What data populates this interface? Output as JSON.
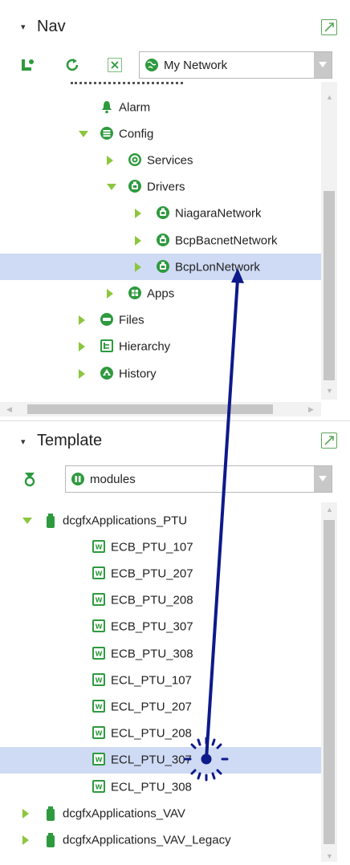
{
  "nav": {
    "title": "Nav",
    "network_select": "My Network",
    "tree": [
      {
        "label": "Alarm",
        "icon": "alarm-bell-icon",
        "toggle": "none",
        "level": 0
      },
      {
        "label": "Config",
        "icon": "config-database-icon",
        "toggle": "down",
        "level": 0
      },
      {
        "label": "Services",
        "icon": "services-gear-icon",
        "toggle": "right",
        "level": 1
      },
      {
        "label": "Drivers",
        "icon": "drivers-icon",
        "toggle": "down",
        "level": 1
      },
      {
        "label": "NiagaraNetwork",
        "icon": "network-icon",
        "toggle": "right",
        "level": 2
      },
      {
        "label": "BcpBacnetNetwork",
        "icon": "network-icon",
        "toggle": "right",
        "level": 2
      },
      {
        "label": "BcpLonNetwork",
        "icon": "network-icon",
        "toggle": "right",
        "level": 2,
        "selected": true
      },
      {
        "label": "Apps",
        "icon": "apps-icon",
        "toggle": "right",
        "level": 1
      },
      {
        "label": "Files",
        "icon": "files-drive-icon",
        "toggle": "right",
        "level": 0
      },
      {
        "label": "Hierarchy",
        "icon": "hierarchy-icon",
        "toggle": "right",
        "level": 0
      },
      {
        "label": "History",
        "icon": "history-icon",
        "toggle": "right",
        "level": 0
      }
    ]
  },
  "template": {
    "title": "Template",
    "module_select": "modules",
    "tree": [
      {
        "label": "dcgfxApplications_PTU",
        "icon": "module-jar-icon",
        "toggle": "down",
        "level": 0
      },
      {
        "label": "ECB_PTU_107",
        "icon": "app-template-icon",
        "toggle": "none",
        "level": 1
      },
      {
        "label": "ECB_PTU_207",
        "icon": "app-template-icon",
        "toggle": "none",
        "level": 1
      },
      {
        "label": "ECB_PTU_208",
        "icon": "app-template-icon",
        "toggle": "none",
        "level": 1
      },
      {
        "label": "ECB_PTU_307",
        "icon": "app-template-icon",
        "toggle": "none",
        "level": 1
      },
      {
        "label": "ECB_PTU_308",
        "icon": "app-template-icon",
        "toggle": "none",
        "level": 1
      },
      {
        "label": "ECL_PTU_107",
        "icon": "app-template-icon",
        "toggle": "none",
        "level": 1
      },
      {
        "label": "ECL_PTU_207",
        "icon": "app-template-icon",
        "toggle": "none",
        "level": 1
      },
      {
        "label": "ECL_PTU_208",
        "icon": "app-template-icon",
        "toggle": "none",
        "level": 1
      },
      {
        "label": "ECL_PTU_307",
        "icon": "app-template-icon",
        "toggle": "none",
        "level": 1,
        "selected": true
      },
      {
        "label": "ECL_PTU_308",
        "icon": "app-template-icon",
        "toggle": "none",
        "level": 1
      },
      {
        "label": "dcgfxApplications_VAV",
        "icon": "module-jar-icon",
        "toggle": "right",
        "level": 0
      },
      {
        "label": "dcgfxApplications_VAV_Legacy",
        "icon": "module-jar-icon",
        "toggle": "right",
        "level": 0
      }
    ]
  },
  "colors": {
    "selection": "#cfdaf4",
    "accent_green": "#8cc63f",
    "icon_green": "#2e9a3e",
    "drag_arrow": "#0d1a8a"
  }
}
